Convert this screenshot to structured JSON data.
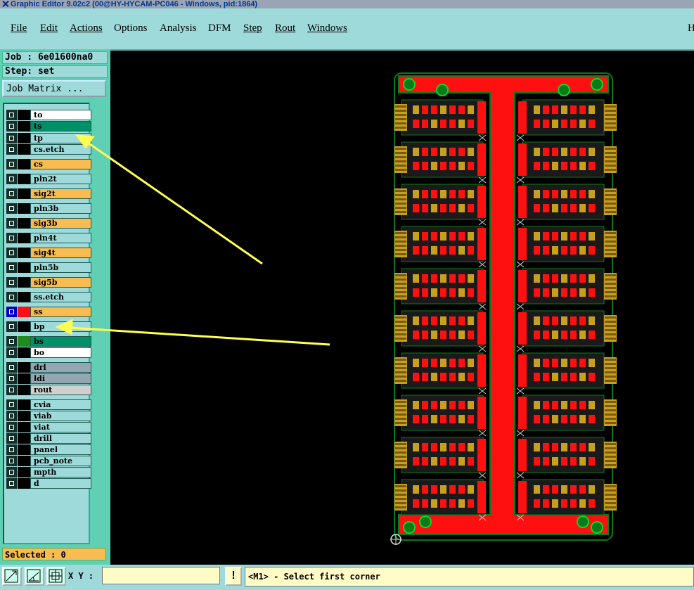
{
  "window": {
    "title": "Graphic Editor 9.02c2 (00@HY-HYCAM-PC046 - Windows, pid:1864)"
  },
  "menu": {
    "items": [
      {
        "label": "File"
      },
      {
        "label": "Edit"
      },
      {
        "label": "Actions"
      },
      {
        "label": "Options"
      },
      {
        "label": "Analysis"
      },
      {
        "label": "DFM"
      },
      {
        "label": "Step"
      },
      {
        "label": "Rout"
      },
      {
        "label": "Windows"
      }
    ],
    "right_label": "H"
  },
  "panel": {
    "job": "Job : 6e01600na0",
    "step": "Step: set",
    "job_matrix": "Job Matrix ...",
    "selected": "Selected : 0"
  },
  "layers": [
    {
      "name": "to",
      "color": "#ffffff"
    },
    {
      "name": "ts",
      "color": "#009068"
    },
    {
      "name": "tp",
      "color": "#9edada"
    },
    {
      "name": "cs.etch",
      "color": "#9edada"
    },
    {
      "name": "cs",
      "color": "#f8bc50"
    },
    {
      "name": "pln2t",
      "color": "#9edada"
    },
    {
      "name": "sig2t",
      "color": "#f8bc50"
    },
    {
      "name": "pln3b",
      "color": "#9edada"
    },
    {
      "name": "sig3b",
      "color": "#f8bc50"
    },
    {
      "name": "pln4t",
      "color": "#9edada"
    },
    {
      "name": "sig4t",
      "color": "#f8bc50"
    },
    {
      "name": "pln5b",
      "color": "#9edada"
    },
    {
      "name": "sig5b",
      "color": "#f8bc50"
    },
    {
      "name": "ss.etch",
      "color": "#9edada"
    },
    {
      "name": "ss",
      "color": "#f8bc50"
    },
    {
      "name": "bp",
      "color": "#9edada"
    },
    {
      "name": "bs",
      "color": "#009068"
    },
    {
      "name": "bo",
      "color": "#ffffff"
    },
    {
      "name": "drl",
      "color": "#93a7b3"
    },
    {
      "name": "ldi",
      "color": "#93a7b3"
    },
    {
      "name": "rout",
      "color": "#d0d0d0"
    },
    {
      "name": "cvia",
      "color": "#9edada"
    },
    {
      "name": "viab",
      "color": "#9edada"
    },
    {
      "name": "viat",
      "color": "#9edada"
    },
    {
      "name": "drill",
      "color": "#9edada"
    },
    {
      "name": "panel",
      "color": "#9edada"
    },
    {
      "name": "pcb_note",
      "color": "#9edada"
    },
    {
      "name": "mpth",
      "color": "#9edada"
    },
    {
      "name": "d",
      "color": "#9edada"
    }
  ],
  "toolbar": {
    "xy_label": "X Y :",
    "xy_value": "",
    "warning_glyph": "!",
    "status_message": "<M1> - Select first corner"
  },
  "colors": {
    "board_red": "#ff1010",
    "board_green": "#0a7a1a",
    "gold": "#c8a020",
    "annotation_arrow": "#ffff50"
  }
}
